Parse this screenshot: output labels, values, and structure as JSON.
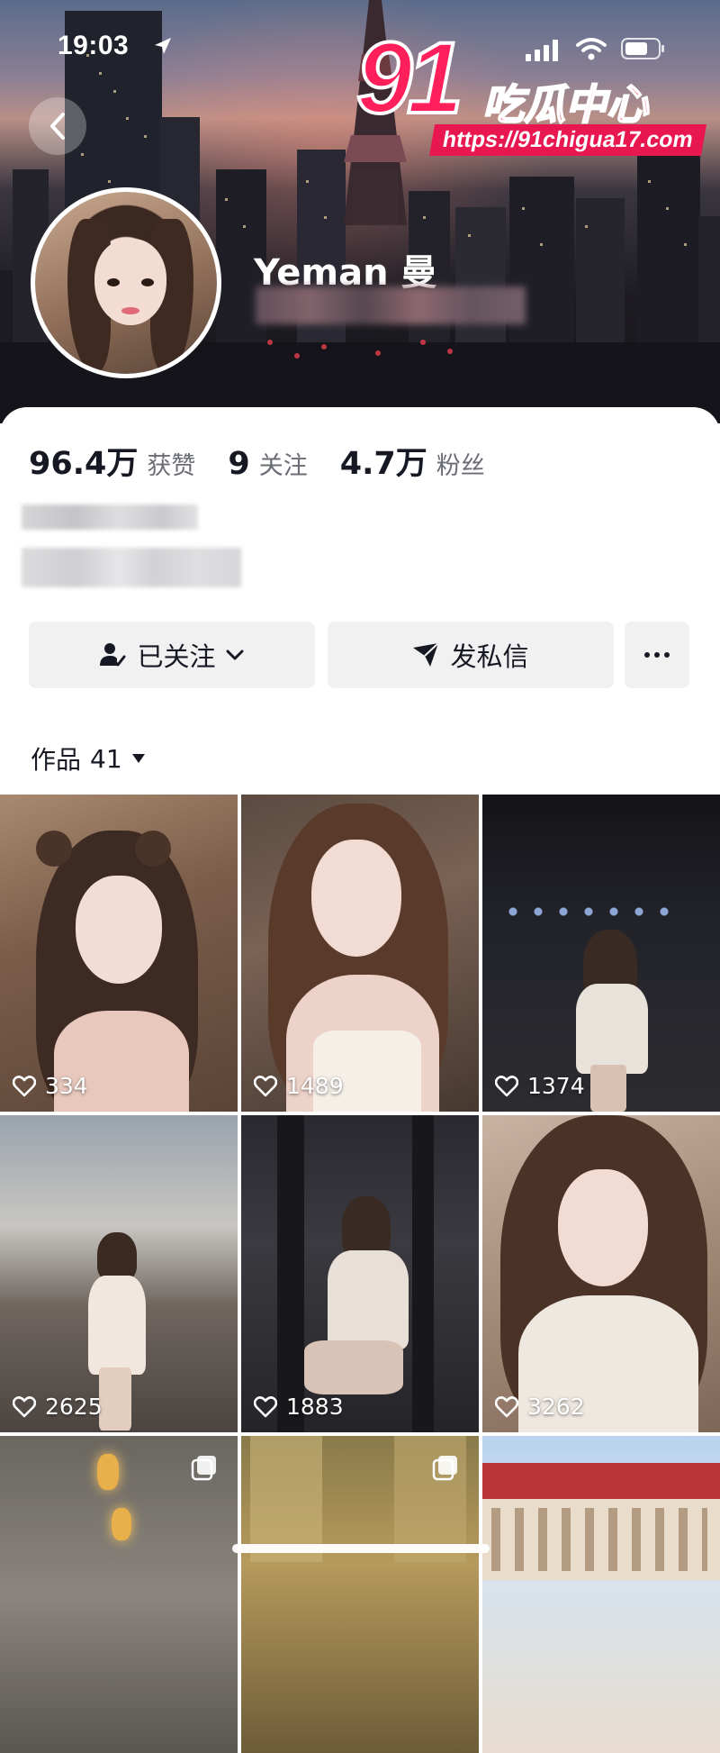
{
  "status_bar": {
    "time": "19:03"
  },
  "watermark": {
    "number": "91",
    "chinese": "吃瓜中心",
    "url": "https://91chigua17.com"
  },
  "profile": {
    "display_name": "Yeman 曼"
  },
  "stats": [
    {
      "value": "96.4万",
      "label": "获赞"
    },
    {
      "value": "9",
      "label": "关注"
    },
    {
      "value": "4.7万",
      "label": "粉丝"
    }
  ],
  "actions": {
    "follow_label": "已关注",
    "message_label": "发私信",
    "more_label": "···"
  },
  "tabs": {
    "works_label": "作品",
    "works_count": "41"
  },
  "posts": [
    {
      "likes": "334"
    },
    {
      "likes": "1489"
    },
    {
      "likes": "1374"
    },
    {
      "likes": "2625"
    },
    {
      "likes": "1883"
    },
    {
      "likes": "3262"
    },
    {
      "likes": ""
    },
    {
      "likes": ""
    },
    {
      "likes": ""
    }
  ],
  "icons": {
    "back": "chevron-left-icon",
    "location": "location-arrow-icon",
    "signal": "signal-icon",
    "wifi": "wifi-icon",
    "battery": "battery-icon",
    "follow": "user-check-icon",
    "follow_caret": "chevron-down-icon",
    "message": "send-icon",
    "more": "more-icon",
    "works_caret": "caret-down-icon",
    "like": "heart-icon",
    "multi": "multiple-images-icon"
  },
  "colors": {
    "watermark_red": "#ff1f5a",
    "text_primary": "#161823",
    "text_secondary": "#6b6d76",
    "button_bg": "#f1f1f2"
  }
}
